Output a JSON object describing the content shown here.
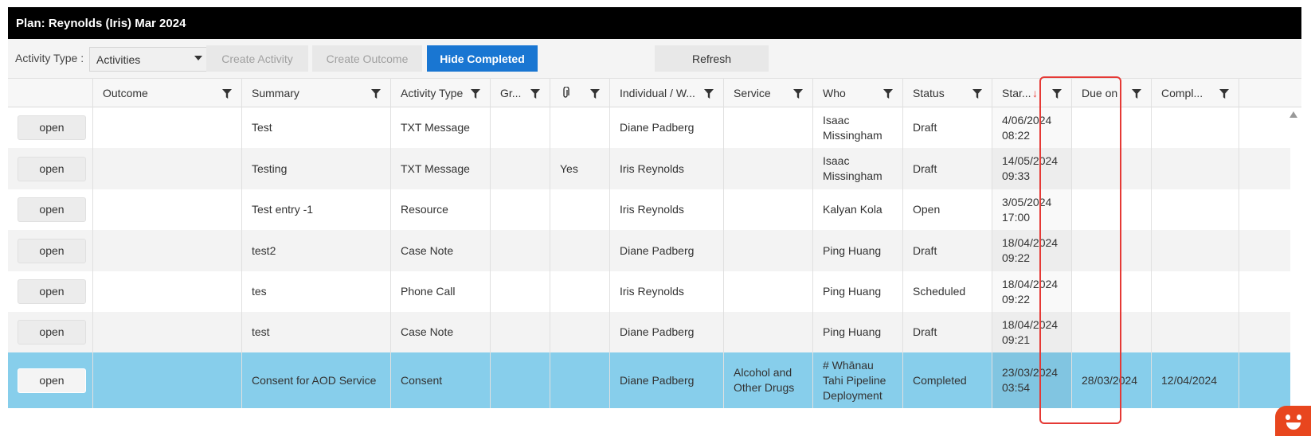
{
  "title": "Plan: Reynolds (Iris) Mar 2024",
  "toolbar": {
    "activity_type_label": "Activity Type :",
    "activity_type_value": "Activities",
    "create_activity": "Create Activity",
    "create_outcome": "Create Outcome",
    "hide_completed": "Hide Completed",
    "refresh": "Refresh"
  },
  "columns": [
    {
      "key": "open",
      "label": ""
    },
    {
      "key": "outcome",
      "label": "Outcome"
    },
    {
      "key": "summary",
      "label": "Summary"
    },
    {
      "key": "activity_type",
      "label": "Activity Type"
    },
    {
      "key": "group",
      "label": "Gr..."
    },
    {
      "key": "attachment",
      "label": ""
    },
    {
      "key": "individual",
      "label": "Individual / W..."
    },
    {
      "key": "service",
      "label": "Service"
    },
    {
      "key": "who",
      "label": "Who"
    },
    {
      "key": "status",
      "label": "Status"
    },
    {
      "key": "start",
      "label": "Star..."
    },
    {
      "key": "due",
      "label": "Due on"
    },
    {
      "key": "completed",
      "label": "Compl..."
    }
  ],
  "sort": {
    "column": "start",
    "direction": "descending"
  },
  "open_label": "open",
  "rows": [
    {
      "outcome": "",
      "summary": "Test",
      "activity_type": "TXT Message",
      "group": "",
      "attachment": "",
      "individual": "Diane Padberg",
      "service": "",
      "who": "Isaac Missingham",
      "status": "Draft",
      "start": "4/06/2024 08:22",
      "due": "",
      "completed": "",
      "selected": false
    },
    {
      "outcome": "",
      "summary": "Testing",
      "activity_type": "TXT Message",
      "group": "",
      "attachment": "Yes",
      "individual": "Iris Reynolds",
      "service": "",
      "who": "Isaac Missingham",
      "status": "Draft",
      "start": "14/05/2024 09:33",
      "due": "",
      "completed": "",
      "selected": false
    },
    {
      "outcome": "",
      "summary": "Test entry -1",
      "activity_type": "Resource",
      "group": "",
      "attachment": "",
      "individual": "Iris Reynolds",
      "service": "",
      "who": "Kalyan Kola",
      "status": "Open",
      "start": "3/05/2024 17:00",
      "due": "",
      "completed": "",
      "selected": false
    },
    {
      "outcome": "",
      "summary": "test2",
      "activity_type": "Case Note",
      "group": "",
      "attachment": "",
      "individual": "Diane Padberg",
      "service": "",
      "who": "Ping Huang",
      "status": "Draft",
      "start": "18/04/2024 09:22",
      "due": "",
      "completed": "",
      "selected": false
    },
    {
      "outcome": "",
      "summary": "tes",
      "activity_type": "Phone Call",
      "group": "",
      "attachment": "",
      "individual": "Iris Reynolds",
      "service": "",
      "who": "Ping Huang",
      "status": "Scheduled",
      "start": "18/04/2024 09:22",
      "due": "",
      "completed": "",
      "selected": false
    },
    {
      "outcome": "",
      "summary": "test",
      "activity_type": "Case Note",
      "group": "",
      "attachment": "",
      "individual": "Diane Padberg",
      "service": "",
      "who": "Ping Huang",
      "status": "Draft",
      "start": "18/04/2024 09:21",
      "due": "",
      "completed": "",
      "selected": false
    },
    {
      "outcome": "",
      "summary": "Consent for AOD Service",
      "activity_type": "Consent",
      "group": "",
      "attachment": "",
      "individual": "Diane Padberg",
      "service": "Alcohol and Other Drugs",
      "who": "# Whānau Tahi Pipeline Deployment",
      "status": "Completed",
      "start": "23/03/2024 03:54",
      "due": "28/03/2024",
      "completed": "12/04/2024",
      "selected": true
    }
  ],
  "colors": {
    "title_bg": "#000000",
    "primary_button": "#1976d2",
    "selected_row": "#87ceeb",
    "highlight_outline": "#e53935",
    "sort_arrow": "#e53935"
  },
  "icons": [
    "filter-icon",
    "paperclip-icon",
    "sort-arrow-down-icon",
    "caret-down-icon",
    "scroll-up-icon",
    "chat-mascot-icon"
  ]
}
